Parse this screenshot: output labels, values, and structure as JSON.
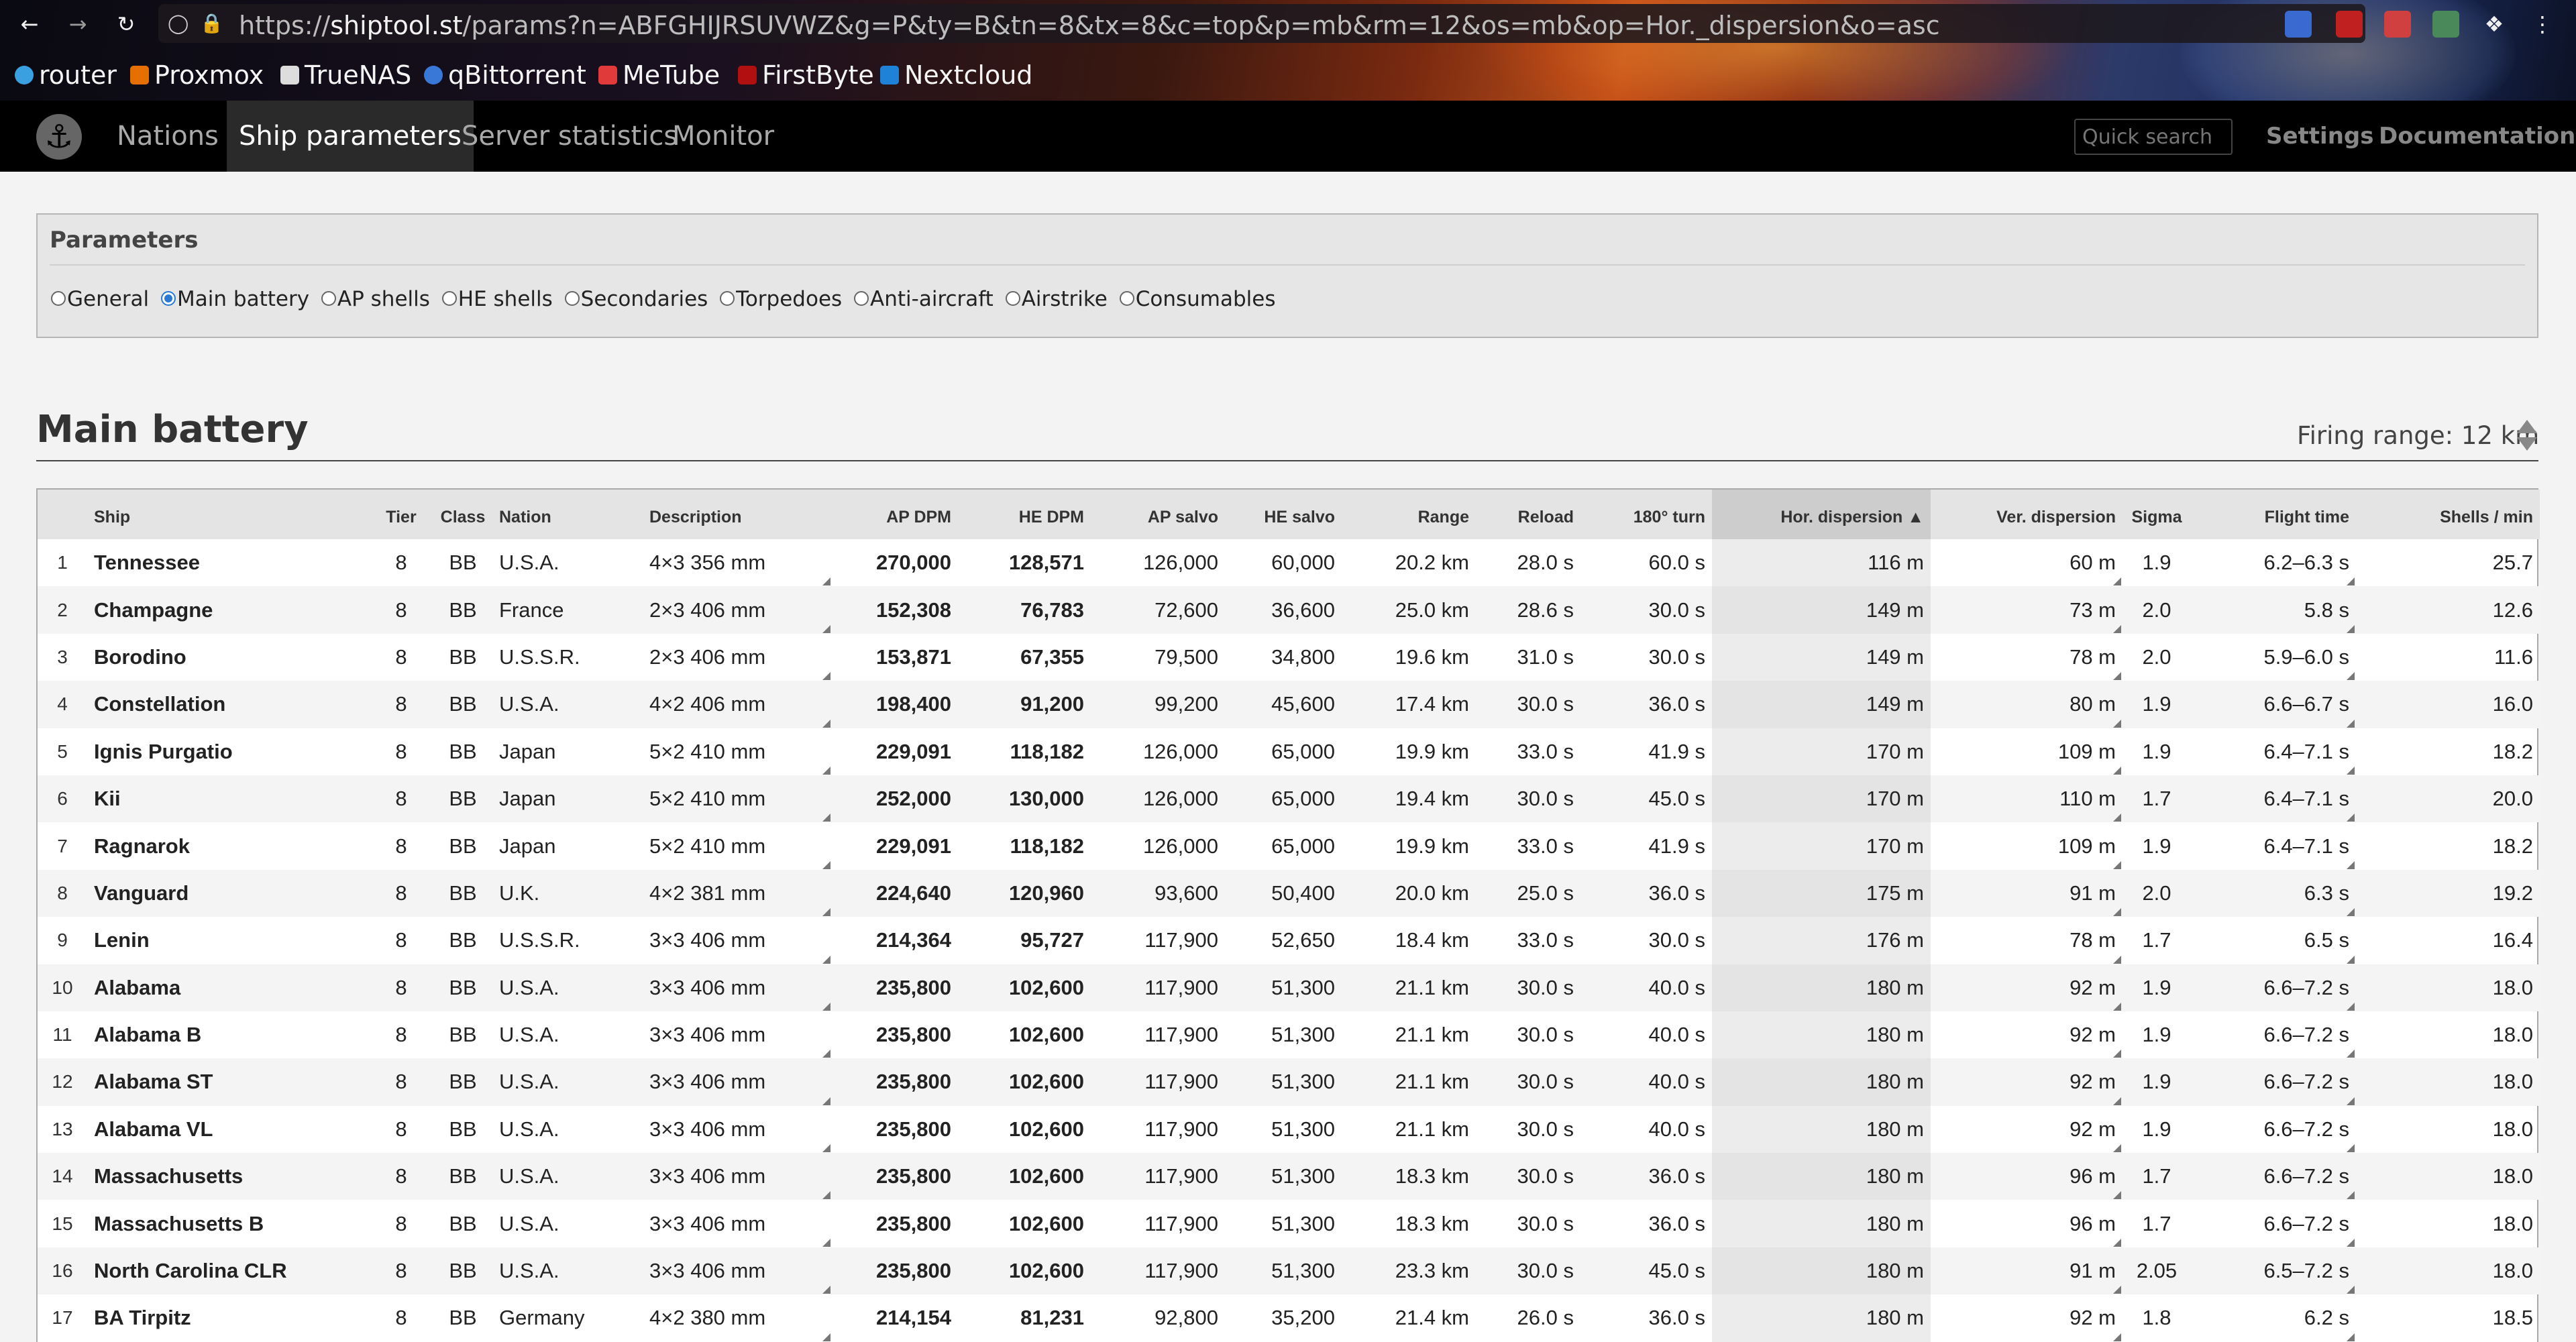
{
  "browser": {
    "url_prefix": "https://",
    "url_domain": "shiptool.st",
    "url_rest": "/params?n=ABFGHIJRSUVWZ&g=P&ty=B&tn=8&tx=8&c=top&p=mb&rm=12&os=mb&op=Hor._dispersion&o=asc",
    "bookmarks": [
      "router",
      "Proxmox",
      "TrueNAS",
      "qBittorrent",
      "MeTube",
      "FirstByte",
      "Nextcloud"
    ]
  },
  "nav": {
    "links": [
      "Nations",
      "Ship parameters",
      "Server statistics",
      "Monitor"
    ],
    "search_placeholder": "Quick search",
    "right": [
      "Settings",
      "Documentation"
    ]
  },
  "parameters": {
    "title": "Parameters",
    "options": [
      "General",
      "Main battery",
      "AP shells",
      "HE shells",
      "Secondaries",
      "Torpedoes",
      "Anti-aircraft",
      "Airstrike",
      "Consumables"
    ],
    "selected": "Main battery"
  },
  "section": {
    "title": "Main battery",
    "firing_range": "Firing range: 12 km"
  },
  "table": {
    "headers": [
      "",
      "Ship",
      "Tier",
      "Class",
      "Nation",
      "Description",
      "AP DPM",
      "HE DPM",
      "AP salvo",
      "HE salvo",
      "Range",
      "Reload",
      "180° turn",
      "Hor. dispersion ▲",
      "Ver. dispersion",
      "Sigma",
      "Flight time",
      "Shells / min"
    ],
    "rows": [
      [
        "1",
        "Tennessee",
        "8",
        "BB",
        "U.S.A.",
        "4×3 356 mm",
        "270,000",
        "128,571",
        "126,000",
        "60,000",
        "20.2 km",
        "28.0 s",
        "60.0 s",
        "116 m",
        "60 m",
        "1.9",
        "6.2–6.3 s",
        "25.7"
      ],
      [
        "2",
        "Champagne",
        "8",
        "BB",
        "France",
        "2×3 406 mm",
        "152,308",
        "76,783",
        "72,600",
        "36,600",
        "25.0 km",
        "28.6 s",
        "30.0 s",
        "149 m",
        "73 m",
        "2.0",
        "5.8 s",
        "12.6"
      ],
      [
        "3",
        "Borodino",
        "8",
        "BB",
        "U.S.S.R.",
        "2×3 406 mm",
        "153,871",
        "67,355",
        "79,500",
        "34,800",
        "19.6 km",
        "31.0 s",
        "30.0 s",
        "149 m",
        "78 m",
        "2.0",
        "5.9–6.0 s",
        "11.6"
      ],
      [
        "4",
        "Constellation",
        "8",
        "BB",
        "U.S.A.",
        "4×2 406 mm",
        "198,400",
        "91,200",
        "99,200",
        "45,600",
        "17.4 km",
        "30.0 s",
        "36.0 s",
        "149 m",
        "80 m",
        "1.9",
        "6.6–6.7 s",
        "16.0"
      ],
      [
        "5",
        "Ignis Purgatio",
        "8",
        "BB",
        "Japan",
        "5×2 410 mm",
        "229,091",
        "118,182",
        "126,000",
        "65,000",
        "19.9 km",
        "33.0 s",
        "41.9 s",
        "170 m",
        "109 m",
        "1.9",
        "6.4–7.1 s",
        "18.2"
      ],
      [
        "6",
        "Kii",
        "8",
        "BB",
        "Japan",
        "5×2 410 mm",
        "252,000",
        "130,000",
        "126,000",
        "65,000",
        "19.4 km",
        "30.0 s",
        "45.0 s",
        "170 m",
        "110 m",
        "1.7",
        "6.4–7.1 s",
        "20.0"
      ],
      [
        "7",
        "Ragnarok",
        "8",
        "BB",
        "Japan",
        "5×2 410 mm",
        "229,091",
        "118,182",
        "126,000",
        "65,000",
        "19.9 km",
        "33.0 s",
        "41.9 s",
        "170 m",
        "109 m",
        "1.9",
        "6.4–7.1 s",
        "18.2"
      ],
      [
        "8",
        "Vanguard",
        "8",
        "BB",
        "U.K.",
        "4×2 381 mm",
        "224,640",
        "120,960",
        "93,600",
        "50,400",
        "20.0 km",
        "25.0 s",
        "36.0 s",
        "175 m",
        "91 m",
        "2.0",
        "6.3 s",
        "19.2"
      ],
      [
        "9",
        "Lenin",
        "8",
        "BB",
        "U.S.S.R.",
        "3×3 406 mm",
        "214,364",
        "95,727",
        "117,900",
        "52,650",
        "18.4 km",
        "33.0 s",
        "30.0 s",
        "176 m",
        "78 m",
        "1.7",
        "6.5 s",
        "16.4"
      ],
      [
        "10",
        "Alabama",
        "8",
        "BB",
        "U.S.A.",
        "3×3 406 mm",
        "235,800",
        "102,600",
        "117,900",
        "51,300",
        "21.1 km",
        "30.0 s",
        "40.0 s",
        "180 m",
        "92 m",
        "1.9",
        "6.6–7.2 s",
        "18.0"
      ],
      [
        "11",
        "Alabama B",
        "8",
        "BB",
        "U.S.A.",
        "3×3 406 mm",
        "235,800",
        "102,600",
        "117,900",
        "51,300",
        "21.1 km",
        "30.0 s",
        "40.0 s",
        "180 m",
        "92 m",
        "1.9",
        "6.6–7.2 s",
        "18.0"
      ],
      [
        "12",
        "Alabama ST",
        "8",
        "BB",
        "U.S.A.",
        "3×3 406 mm",
        "235,800",
        "102,600",
        "117,900",
        "51,300",
        "21.1 km",
        "30.0 s",
        "40.0 s",
        "180 m",
        "92 m",
        "1.9",
        "6.6–7.2 s",
        "18.0"
      ],
      [
        "13",
        "Alabama VL",
        "8",
        "BB",
        "U.S.A.",
        "3×3 406 mm",
        "235,800",
        "102,600",
        "117,900",
        "51,300",
        "21.1 km",
        "30.0 s",
        "40.0 s",
        "180 m",
        "92 m",
        "1.9",
        "6.6–7.2 s",
        "18.0"
      ],
      [
        "14",
        "Massachusetts",
        "8",
        "BB",
        "U.S.A.",
        "3×3 406 mm",
        "235,800",
        "102,600",
        "117,900",
        "51,300",
        "18.3 km",
        "30.0 s",
        "36.0 s",
        "180 m",
        "96 m",
        "1.7",
        "6.6–7.2 s",
        "18.0"
      ],
      [
        "15",
        "Massachusetts B",
        "8",
        "BB",
        "U.S.A.",
        "3×3 406 mm",
        "235,800",
        "102,600",
        "117,900",
        "51,300",
        "18.3 km",
        "30.0 s",
        "36.0 s",
        "180 m",
        "96 m",
        "1.7",
        "6.6–7.2 s",
        "18.0"
      ],
      [
        "16",
        "North Carolina CLR",
        "8",
        "BB",
        "U.S.A.",
        "3×3 406 mm",
        "235,800",
        "102,600",
        "117,900",
        "51,300",
        "23.3 km",
        "30.0 s",
        "45.0 s",
        "180 m",
        "91 m",
        "2.05",
        "6.5–7.2 s",
        "18.0"
      ],
      [
        "17",
        "BA Tirpitz",
        "8",
        "BB",
        "Germany",
        "4×2 380 mm",
        "214,154",
        "81,231",
        "92,800",
        "35,200",
        "21.4 km",
        "26.0 s",
        "36.0 s",
        "180 m",
        "92 m",
        "1.8",
        "6.2 s",
        "18.5"
      ]
    ]
  }
}
